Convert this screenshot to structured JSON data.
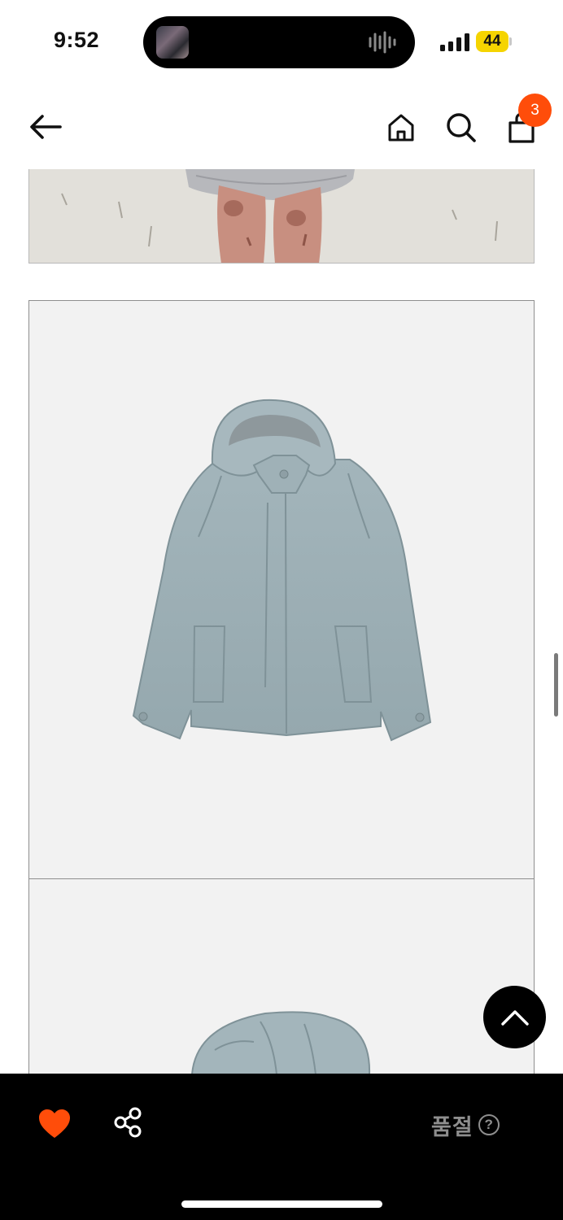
{
  "status_bar": {
    "time": "9:52",
    "battery": "44",
    "battery_color": "#f5d400",
    "icons": [
      "audio-waveform-icon",
      "cellular-signal-icon",
      "battery-icon"
    ]
  },
  "header": {
    "icons": [
      "back-arrow-icon",
      "home-icon",
      "search-icon",
      "shopping-bag-icon"
    ],
    "cart_count": "3",
    "badge_color": "#ff4d0a"
  },
  "content": {
    "images": [
      "model-photo-cropped",
      "product-photo-hooded-jacket-front",
      "product-photo-hooded-jacket-detail"
    ],
    "product_color": "#9fb1b7"
  },
  "bottom_bar": {
    "soldout_label": "품절",
    "help_symbol": "?",
    "like_color": "#ff4d0a",
    "icons": [
      "heart-icon",
      "share-icon",
      "help-circle-icon"
    ]
  },
  "floating": {
    "icons": [
      "scroll-to-top-icon"
    ]
  }
}
